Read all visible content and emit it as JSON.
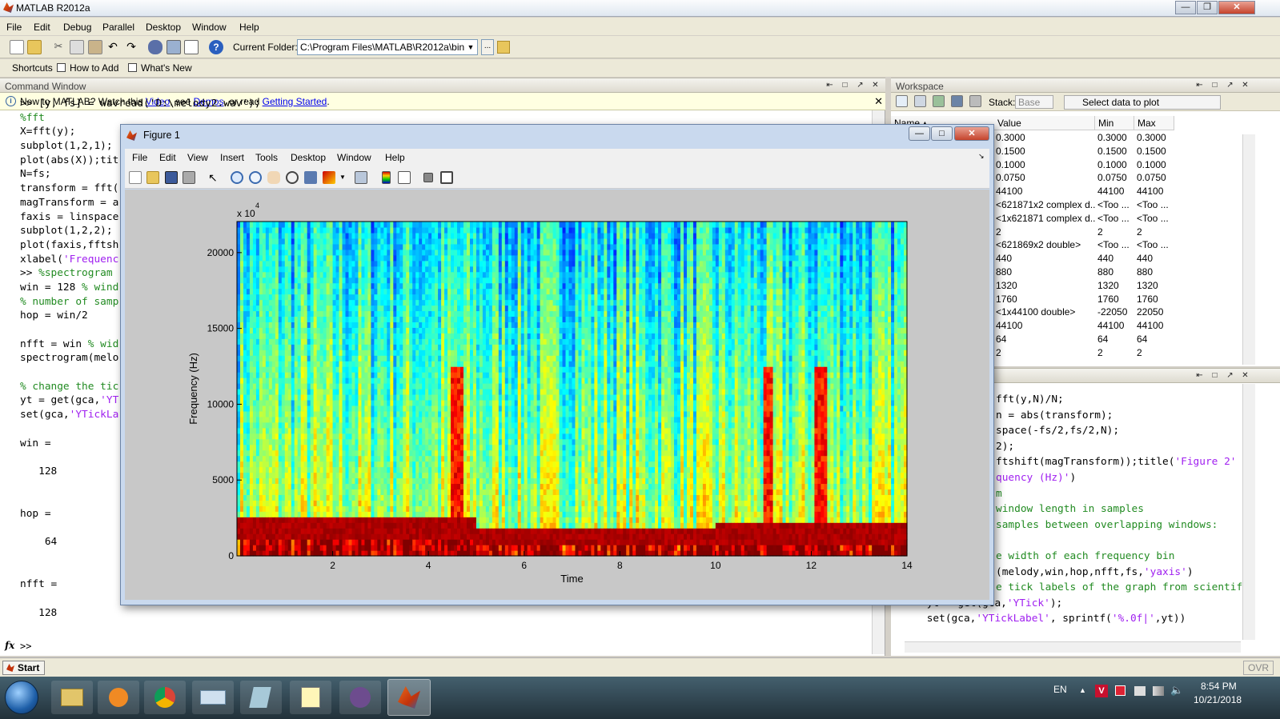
{
  "app": {
    "title": "MATLAB  R2012a"
  },
  "menu": [
    "File",
    "Edit",
    "Debug",
    "Parallel",
    "Desktop",
    "Window",
    "Help"
  ],
  "toolbar": {
    "current_folder_label": "Current Folder:",
    "current_folder_value": "C:\\Program Files\\MATLAB\\R2012a\\bin",
    "browse_label": "..."
  },
  "shortcuts": {
    "label": "Shortcuts",
    "how_to_add": "How to Add",
    "whats_new": "What's New"
  },
  "command_window": {
    "title": "Command Window",
    "info_prefix": "New to MATLAB? Watch this ",
    "info_video": "Video",
    "info_mid1": ", see ",
    "info_demos": "Demos",
    "info_mid2": ", or read ",
    "info_getting_started": "Getting Started",
    "info_suffix": ".",
    "prompt": ">>",
    "fx": "fx",
    "lines": [
      {
        "text": ">> [y, fs] = wavread('D:\\melody2.wav');",
        "cls": ""
      },
      {
        "text": "%fft",
        "cls": "green"
      },
      {
        "text": "X=fft(y);",
        "cls": ""
      },
      {
        "text": "subplot(1,2,1);",
        "cls": ""
      },
      {
        "text": "plot(abs(X));tit",
        "cls": ""
      },
      {
        "text": "N=fs;",
        "cls": ""
      },
      {
        "text": "transform = fft(",
        "cls": ""
      },
      {
        "text": "magTransform = a",
        "cls": ""
      },
      {
        "text": "faxis = linspace",
        "cls": ""
      },
      {
        "text": "subplot(1,2,2);",
        "cls": ""
      },
      {
        "text": "plot(faxis,fftsh",
        "cls": ""
      },
      {
        "text": "xlabel('Frequenc",
        "cls": "mixed1"
      },
      {
        "text": ">> %spectrogram",
        "cls": "mixed2"
      },
      {
        "text": "win = 128 % wind",
        "cls": "mixed3"
      },
      {
        "text": "% number of samp",
        "cls": "green"
      },
      {
        "text": "hop = win/2",
        "cls": ""
      },
      {
        "text": "",
        "cls": ""
      },
      {
        "text": "nfft = win % wid",
        "cls": "mixed4"
      },
      {
        "text": "spectrogram(melo",
        "cls": ""
      },
      {
        "text": "",
        "cls": ""
      },
      {
        "text": "% change the tic",
        "cls": "green"
      },
      {
        "text": "yt = get(gca,'YT",
        "cls": "mixed5"
      },
      {
        "text": "set(gca,'YTickLa",
        "cls": "mixed6"
      },
      {
        "text": "",
        "cls": ""
      },
      {
        "text": "win =",
        "cls": ""
      },
      {
        "text": "",
        "cls": ""
      },
      {
        "text": "   128",
        "cls": ""
      },
      {
        "text": "",
        "cls": ""
      },
      {
        "text": "",
        "cls": ""
      },
      {
        "text": "hop =",
        "cls": ""
      },
      {
        "text": "",
        "cls": ""
      },
      {
        "text": "    64",
        "cls": ""
      },
      {
        "text": "",
        "cls": ""
      },
      {
        "text": "",
        "cls": ""
      },
      {
        "text": "nfft =",
        "cls": ""
      },
      {
        "text": "",
        "cls": ""
      },
      {
        "text": "   128",
        "cls": ""
      }
    ]
  },
  "workspace": {
    "title": "Workspace",
    "stack_label": "Stack:",
    "stack_value": "Base",
    "plot_label": "Select data to plot",
    "headers": {
      "name": "Name ▴",
      "value": "Value",
      "min": "Min",
      "max": "Max"
    },
    "rows": [
      {
        "value": "0.3000",
        "min": "0.3000",
        "max": "0.3000"
      },
      {
        "value": "0.1500",
        "min": "0.1500",
        "max": "0.1500"
      },
      {
        "value": "0.1000",
        "min": "0.1000",
        "max": "0.1000"
      },
      {
        "value": "0.0750",
        "min": "0.0750",
        "max": "0.0750"
      },
      {
        "value": "44100",
        "min": "44100",
        "max": "44100"
      },
      {
        "value": "<621871x2 complex d...",
        "min": "<Too ...",
        "max": "<Too ..."
      },
      {
        "value": "<1x621871 complex d...",
        "min": "<Too ...",
        "max": "<Too ..."
      },
      {
        "value": "2",
        "min": "2",
        "max": "2"
      },
      {
        "value": "<621869x2 double>",
        "min": "<Too ...",
        "max": "<Too ..."
      },
      {
        "value": "440",
        "min": "440",
        "max": "440"
      },
      {
        "value": "880",
        "min": "880",
        "max": "880"
      },
      {
        "value": "1320",
        "min": "1320",
        "max": "1320"
      },
      {
        "value": "1760",
        "min": "1760",
        "max": "1760"
      },
      {
        "value": "<1x44100 double>",
        "min": "-22050",
        "max": "22050"
      },
      {
        "value": "44100",
        "min": "44100",
        "max": "44100"
      },
      {
        "value": "64",
        "min": "64",
        "max": "64"
      },
      {
        "value": "2",
        "min": "2",
        "max": "2"
      }
    ]
  },
  "history": {
    "lines": [
      {
        "plain": "fft(y,N)/N;",
        "str": ""
      },
      {
        "plain": "n = abs(transform);",
        "str": ""
      },
      {
        "plain": "space(-fs/2,fs/2,N);",
        "str": ""
      },
      {
        "plain": "2);",
        "str": ""
      },
      {
        "plain": "ftshift(magTransform));title(",
        "str": "'Figure 2'"
      },
      {
        "plain": "",
        "str": "quency (Hz)'",
        "tail": ")"
      },
      {
        "plain": "",
        "str": "",
        "green": "m"
      },
      {
        "plain": "",
        "str": "",
        "green": "window length in samples"
      },
      {
        "plain": "",
        "str": "",
        "green": "samples between overlapping windows:"
      },
      {
        "plain": "",
        "str": ""
      },
      {
        "plain": "",
        "str": "",
        "green": "e width of each frequency bin"
      },
      {
        "plain": "(melody,win,hop,nfft,fs,",
        "str": "'yaxis'",
        "tail": ")"
      },
      {
        "plain": "",
        "str": "",
        "green": "e tick labels of the graph from scientif"
      },
      {
        "plain": "yt = get(gca,",
        "str": "'YTick'",
        "tail": ");"
      },
      {
        "plain": "set(gca,",
        "str": "'YTickLabel'",
        "tail": ", sprintf(",
        "str2": "'%.0f|'",
        "tail2": ",yt))"
      }
    ]
  },
  "status": {
    "start": "Start",
    "ovr": "OVR"
  },
  "taskbar": {
    "lang": "EN",
    "time": "8:54 PM",
    "date": "10/21/2018"
  },
  "figure": {
    "title": "Figure 1",
    "menu": [
      "File",
      "Edit",
      "View",
      "Insert",
      "Tools",
      "Desktop",
      "Window",
      "Help"
    ]
  },
  "chart_data": {
    "type": "heatmap",
    "title": "",
    "xlabel": "Time",
    "ylabel": "Frequency (Hz)",
    "xlim": [
      0,
      14
    ],
    "ylim": [
      0,
      22050
    ],
    "xticks": [
      2,
      4,
      6,
      8,
      10,
      12,
      14
    ],
    "yticks": [
      0,
      5000,
      10000,
      15000,
      20000
    ],
    "ytick_labels": [
      "0",
      "5000",
      "10000",
      "15000",
      "20000"
    ],
    "exponent_label": "x 10",
    "exponent_power": "4",
    "colormap": "jet",
    "note_bands": [
      {
        "t_start": 0,
        "t_end": 5.0,
        "freq_hz": 1760
      },
      {
        "t_start": 5.0,
        "t_end": 10.0,
        "freq_hz": 1320
      },
      {
        "t_start": 10.0,
        "t_end": 14.0,
        "freq_hz": 1550
      }
    ],
    "transients_time": [
      4.6,
      11.1,
      12.2
    ]
  }
}
